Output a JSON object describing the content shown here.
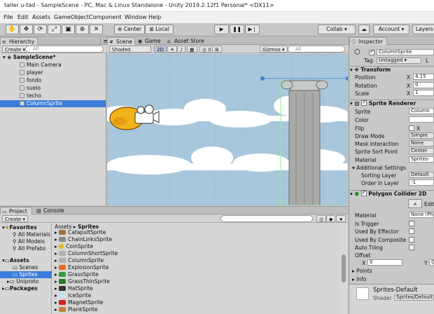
{
  "window": {
    "title": "taller u-tad - SampleScene - PC, Mac & Linux Standalone - Unity 2019.2.12f1 Personal* <DX11>"
  },
  "menu": [
    "File",
    "Edit",
    "Assets",
    "GameObject",
    "Component",
    "Window",
    "Help"
  ],
  "toolbar": {
    "center": "Center",
    "local": "Local",
    "collab": "Collab",
    "account": "Account",
    "layers": "Layers"
  },
  "hierarchy": {
    "tab": "Hierarchy",
    "create": "Create",
    "search_placeholder": "All",
    "scene": "SampleScene*",
    "items": [
      "Main Camera",
      "player",
      "fondo",
      "suelo",
      "techo",
      "ColumnSprite"
    ]
  },
  "scene_view": {
    "tabs": [
      "Scene",
      "Game",
      "Asset Store"
    ],
    "shading": "Shaded",
    "mode": "2D",
    "gizmos": "Gizmos",
    "search_placeholder": "All"
  },
  "project": {
    "tabs": [
      "Project",
      "Console"
    ],
    "create": "Create",
    "favorites": {
      "label": "Favorites",
      "items": [
        "All Materials",
        "All Models",
        "All Prefabs"
      ]
    },
    "assets": {
      "label": "Assets",
      "items": [
        "Scenes",
        "Sprites",
        "Uniproto"
      ]
    },
    "packages": "Packages",
    "breadcrumb": [
      "Assets",
      "Sprites"
    ],
    "sprites": [
      "CatapultSprite",
      "ChainLinksSprite",
      "CoinSprite",
      "ColumnShortSprite",
      "ColumnSprite",
      "ExplosionSprite",
      "GrassSprite",
      "GrassThinSprite",
      "HatSprite",
      "IceSprite",
      "MagnetSprite",
      "PlankSprite"
    ]
  },
  "inspector": {
    "tab": "Inspector",
    "object_name": "ColumnSprite",
    "tag_label": "Tag",
    "tag_value": "Untagged",
    "layer_label": "L",
    "transform": {
      "title": "Transform",
      "position": "Position",
      "rotation": "Rotation",
      "scale": "Scale",
      "x": "X",
      "pos_x": "4.15",
      "rot_x": "0",
      "scale_x": "1"
    },
    "sprite_renderer": {
      "title": "Sprite Renderer",
      "sprite_label": "Sprite",
      "sprite_value": "Column",
      "color_label": "Color",
      "flip_label": "Flip",
      "flip_x": "X",
      "draw_mode_label": "Draw Mode",
      "draw_mode": "Simple",
      "mask_label": "Mask Interaction",
      "mask": "None",
      "sort_point_label": "Sprite Sort Point",
      "sort_point": "Center",
      "material_label": "Material",
      "material": "Sprites-",
      "additional": "Additional Settings",
      "sorting_layer_label": "Sorting Layer",
      "sorting_layer": "Default",
      "order_label": "Order in Layer",
      "order": "-1"
    },
    "collider": {
      "title": "Polygon Collider 2D",
      "edit": "Edit",
      "material_label": "Material",
      "material": "None (Phy",
      "trigger": "Is Trigger",
      "effector": "Used By Effector",
      "composite": "Used By Composite",
      "tiling": "Auto Tiling",
      "offset": "Offset",
      "x": "X",
      "x_val": "0",
      "y": "Y",
      "y_val": "0",
      "points": "Points",
      "info": "Info"
    },
    "material_preview": {
      "name": "Sprites-Default",
      "shader_label": "Shader",
      "shader": "Sprites/Default"
    }
  },
  "colors": {
    "selection": "#3c7ddb",
    "sky": "#a9c7dc",
    "panel": "#c2c2c2"
  }
}
